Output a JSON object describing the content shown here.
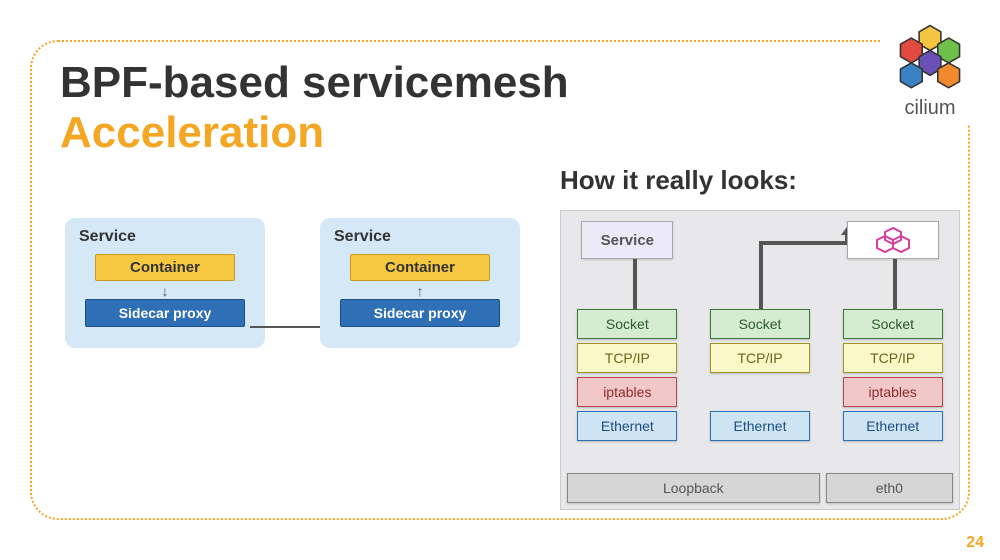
{
  "brand": "cilium",
  "title": "BPF-based servicemesh",
  "subtitle": "Acceleration",
  "right_heading": "How it really looks:",
  "page_number": "24",
  "left_diagram": {
    "service_a": {
      "label": "Service",
      "container": "Container",
      "proxy": "Sidecar proxy"
    },
    "service_b": {
      "label": "Service",
      "container": "Container",
      "proxy": "Sidecar proxy"
    }
  },
  "right_diagram": {
    "col1_top": "Service",
    "col3_top_icon": "proxy-cubes-icon",
    "stack": {
      "socket": "Socket",
      "tcpip": "TCP/IP",
      "iptables": "iptables",
      "ethernet": "Ethernet"
    },
    "bottom": {
      "loopback": "Loopback",
      "eth0": "eth0"
    }
  }
}
